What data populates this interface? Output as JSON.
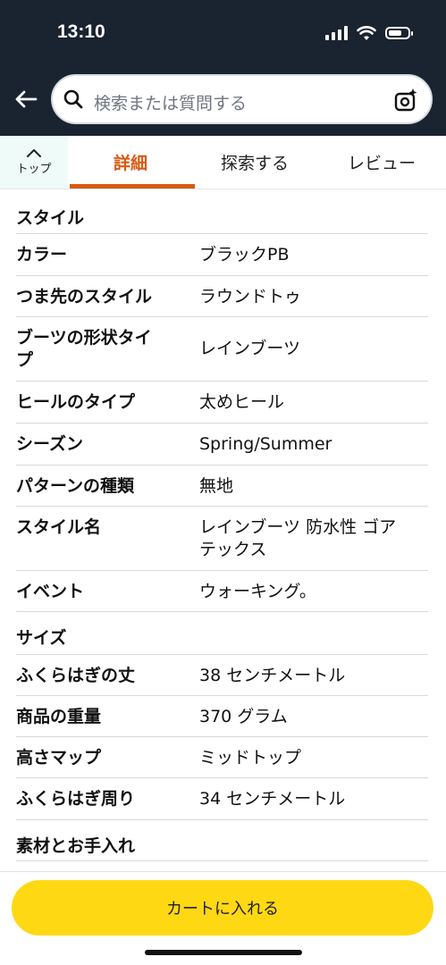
{
  "status_bar": {
    "time": "13:10"
  },
  "header": {
    "back_icon": "back-arrow-icon",
    "search_placeholder": "検索または質問する",
    "camera_icon": "camera-sparkle-icon"
  },
  "tabs": {
    "top_label": "トップ",
    "items": [
      {
        "label": "詳細",
        "active": true
      },
      {
        "label": "探索する",
        "active": false
      },
      {
        "label": "レビュー",
        "active": false
      }
    ],
    "accent_color": "#d85a12"
  },
  "sections": [
    {
      "title": "スタイル",
      "rows": [
        {
          "key": "カラー",
          "value": "ブラックPB"
        },
        {
          "key": "つま先のスタイル",
          "value": "ラウンドトゥ"
        },
        {
          "key": "ブーツの形状タイプ",
          "value": "レインブーツ"
        },
        {
          "key": "ヒールのタイプ",
          "value": "太めヒール"
        },
        {
          "key": "シーズン",
          "value": "Spring/Summer"
        },
        {
          "key": "パターンの種類",
          "value": "無地"
        },
        {
          "key": "スタイル名",
          "value": "レインブーツ 防水性 ゴアテックス"
        },
        {
          "key": "イベント",
          "value": "ウォーキング。"
        }
      ]
    },
    {
      "title": "サイズ",
      "rows": [
        {
          "key": "ふくらはぎの丈",
          "value": "38 センチメートル"
        },
        {
          "key": "商品の重量",
          "value": "370 グラム"
        },
        {
          "key": "高さマップ",
          "value": "ミッドトップ"
        },
        {
          "key": "ふくらはぎ周り",
          "value": "34 センチメートル"
        }
      ]
    },
    {
      "title": "素材とお手入れ",
      "rows": []
    }
  ],
  "cart": {
    "label": "カートに入れる",
    "color": "#ffd814"
  }
}
